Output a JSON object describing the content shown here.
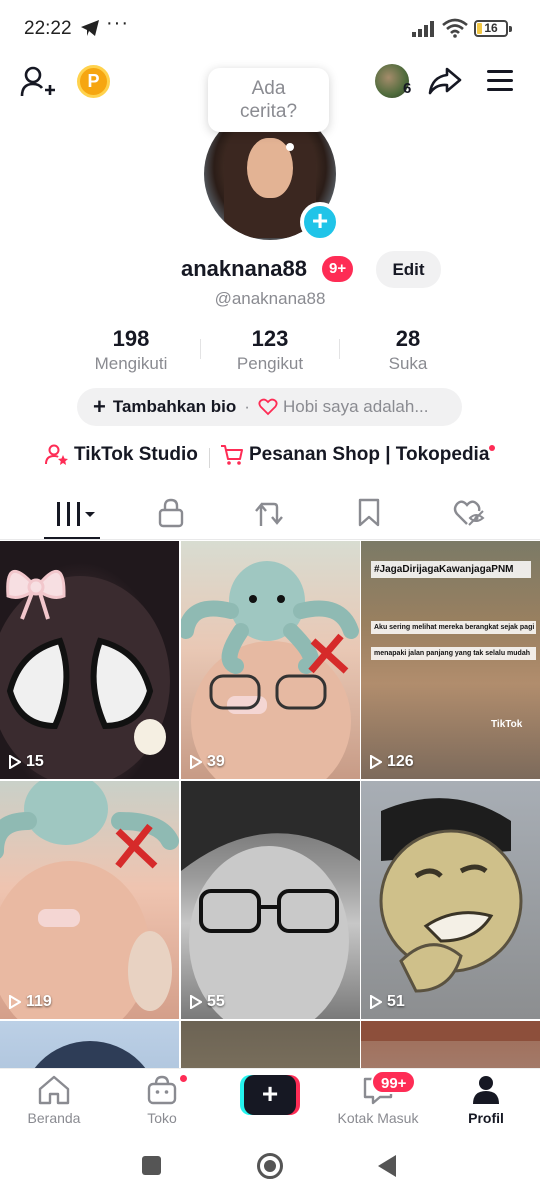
{
  "status_bar": {
    "time": "22:22",
    "more_dots": "···",
    "battery": "16",
    "battery_level": 0.16
  },
  "story_bubble": {
    "line1": "Ada",
    "line2": "cerita?"
  },
  "following_avatar_count": "6",
  "profile": {
    "username": "anaknana88",
    "notification_badge": "9+",
    "edit_label": "Edit",
    "handle": "@anaknana88"
  },
  "stats": [
    {
      "value": "198",
      "label": "Mengikuti"
    },
    {
      "value": "123",
      "label": "Pengikut"
    },
    {
      "value": "28",
      "label": "Suka"
    }
  ],
  "bio": {
    "add_label": "Tambahkan bio",
    "separator": "·",
    "hint": "Hobi saya adalah..."
  },
  "links": {
    "studio": "TikTok Studio",
    "shop": "Pesanan Shop | Tokopedia"
  },
  "tabs": [
    "videos-icon",
    "lock-icon",
    "repost-icon",
    "bookmark-icon",
    "liked-icon"
  ],
  "videos": [
    {
      "views": "15"
    },
    {
      "views": "39"
    },
    {
      "views": "126",
      "overlay_title": "#JagaDirijagaKawanjagaPNM",
      "overlay_line1": "Aku sering melihat mereka berangkat sejak pagi",
      "overlay_line2": "menapaki jalan panjang yang tak selalu mudah",
      "watermark": "TikTok"
    },
    {
      "views": "119"
    },
    {
      "views": "55"
    },
    {
      "views": "51"
    }
  ],
  "bottom_nav": {
    "home": "Beranda",
    "shop": "Toko",
    "inbox": "Kotak Masuk",
    "inbox_badge": "99+",
    "profile": "Profil"
  },
  "colors": {
    "accent": "#fe2c55",
    "cyan": "#25f4ee",
    "add_button": "#20c4e8",
    "text_primary": "#161823",
    "text_secondary": "#8a8b91"
  }
}
